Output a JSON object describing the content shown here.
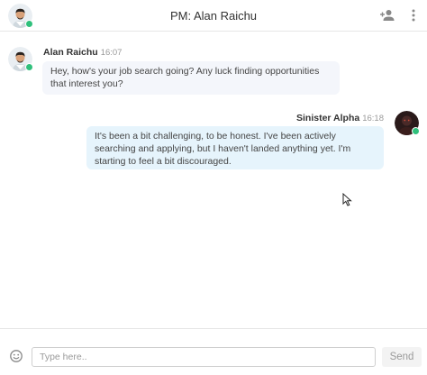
{
  "header": {
    "title": "PM: Alan Raichu",
    "avatar_icon": "user-avatar-icon",
    "add_user_icon": "add-user-icon",
    "more_icon": "more-vertical-icon"
  },
  "messages": [
    {
      "direction": "received",
      "sender": "Alan Raichu",
      "time": "16:07",
      "text": "Hey, how's your job search going? Any luck finding opportunities that interest you?"
    },
    {
      "direction": "sent",
      "sender": "Sinister Alpha",
      "time": "16:18",
      "text": "It's been a bit challenging, to be honest. I've been actively searching and applying, but I haven't landed anything yet. I'm starting to feel a bit discouraged."
    }
  ],
  "composer": {
    "placeholder": "Type here..",
    "value": "",
    "send_label": "Send",
    "emoji_icon": "emoji-icon"
  },
  "colors": {
    "online": "#30c07c",
    "received_bubble": "#f4f6fb",
    "sent_bubble": "#e6f4fc"
  }
}
